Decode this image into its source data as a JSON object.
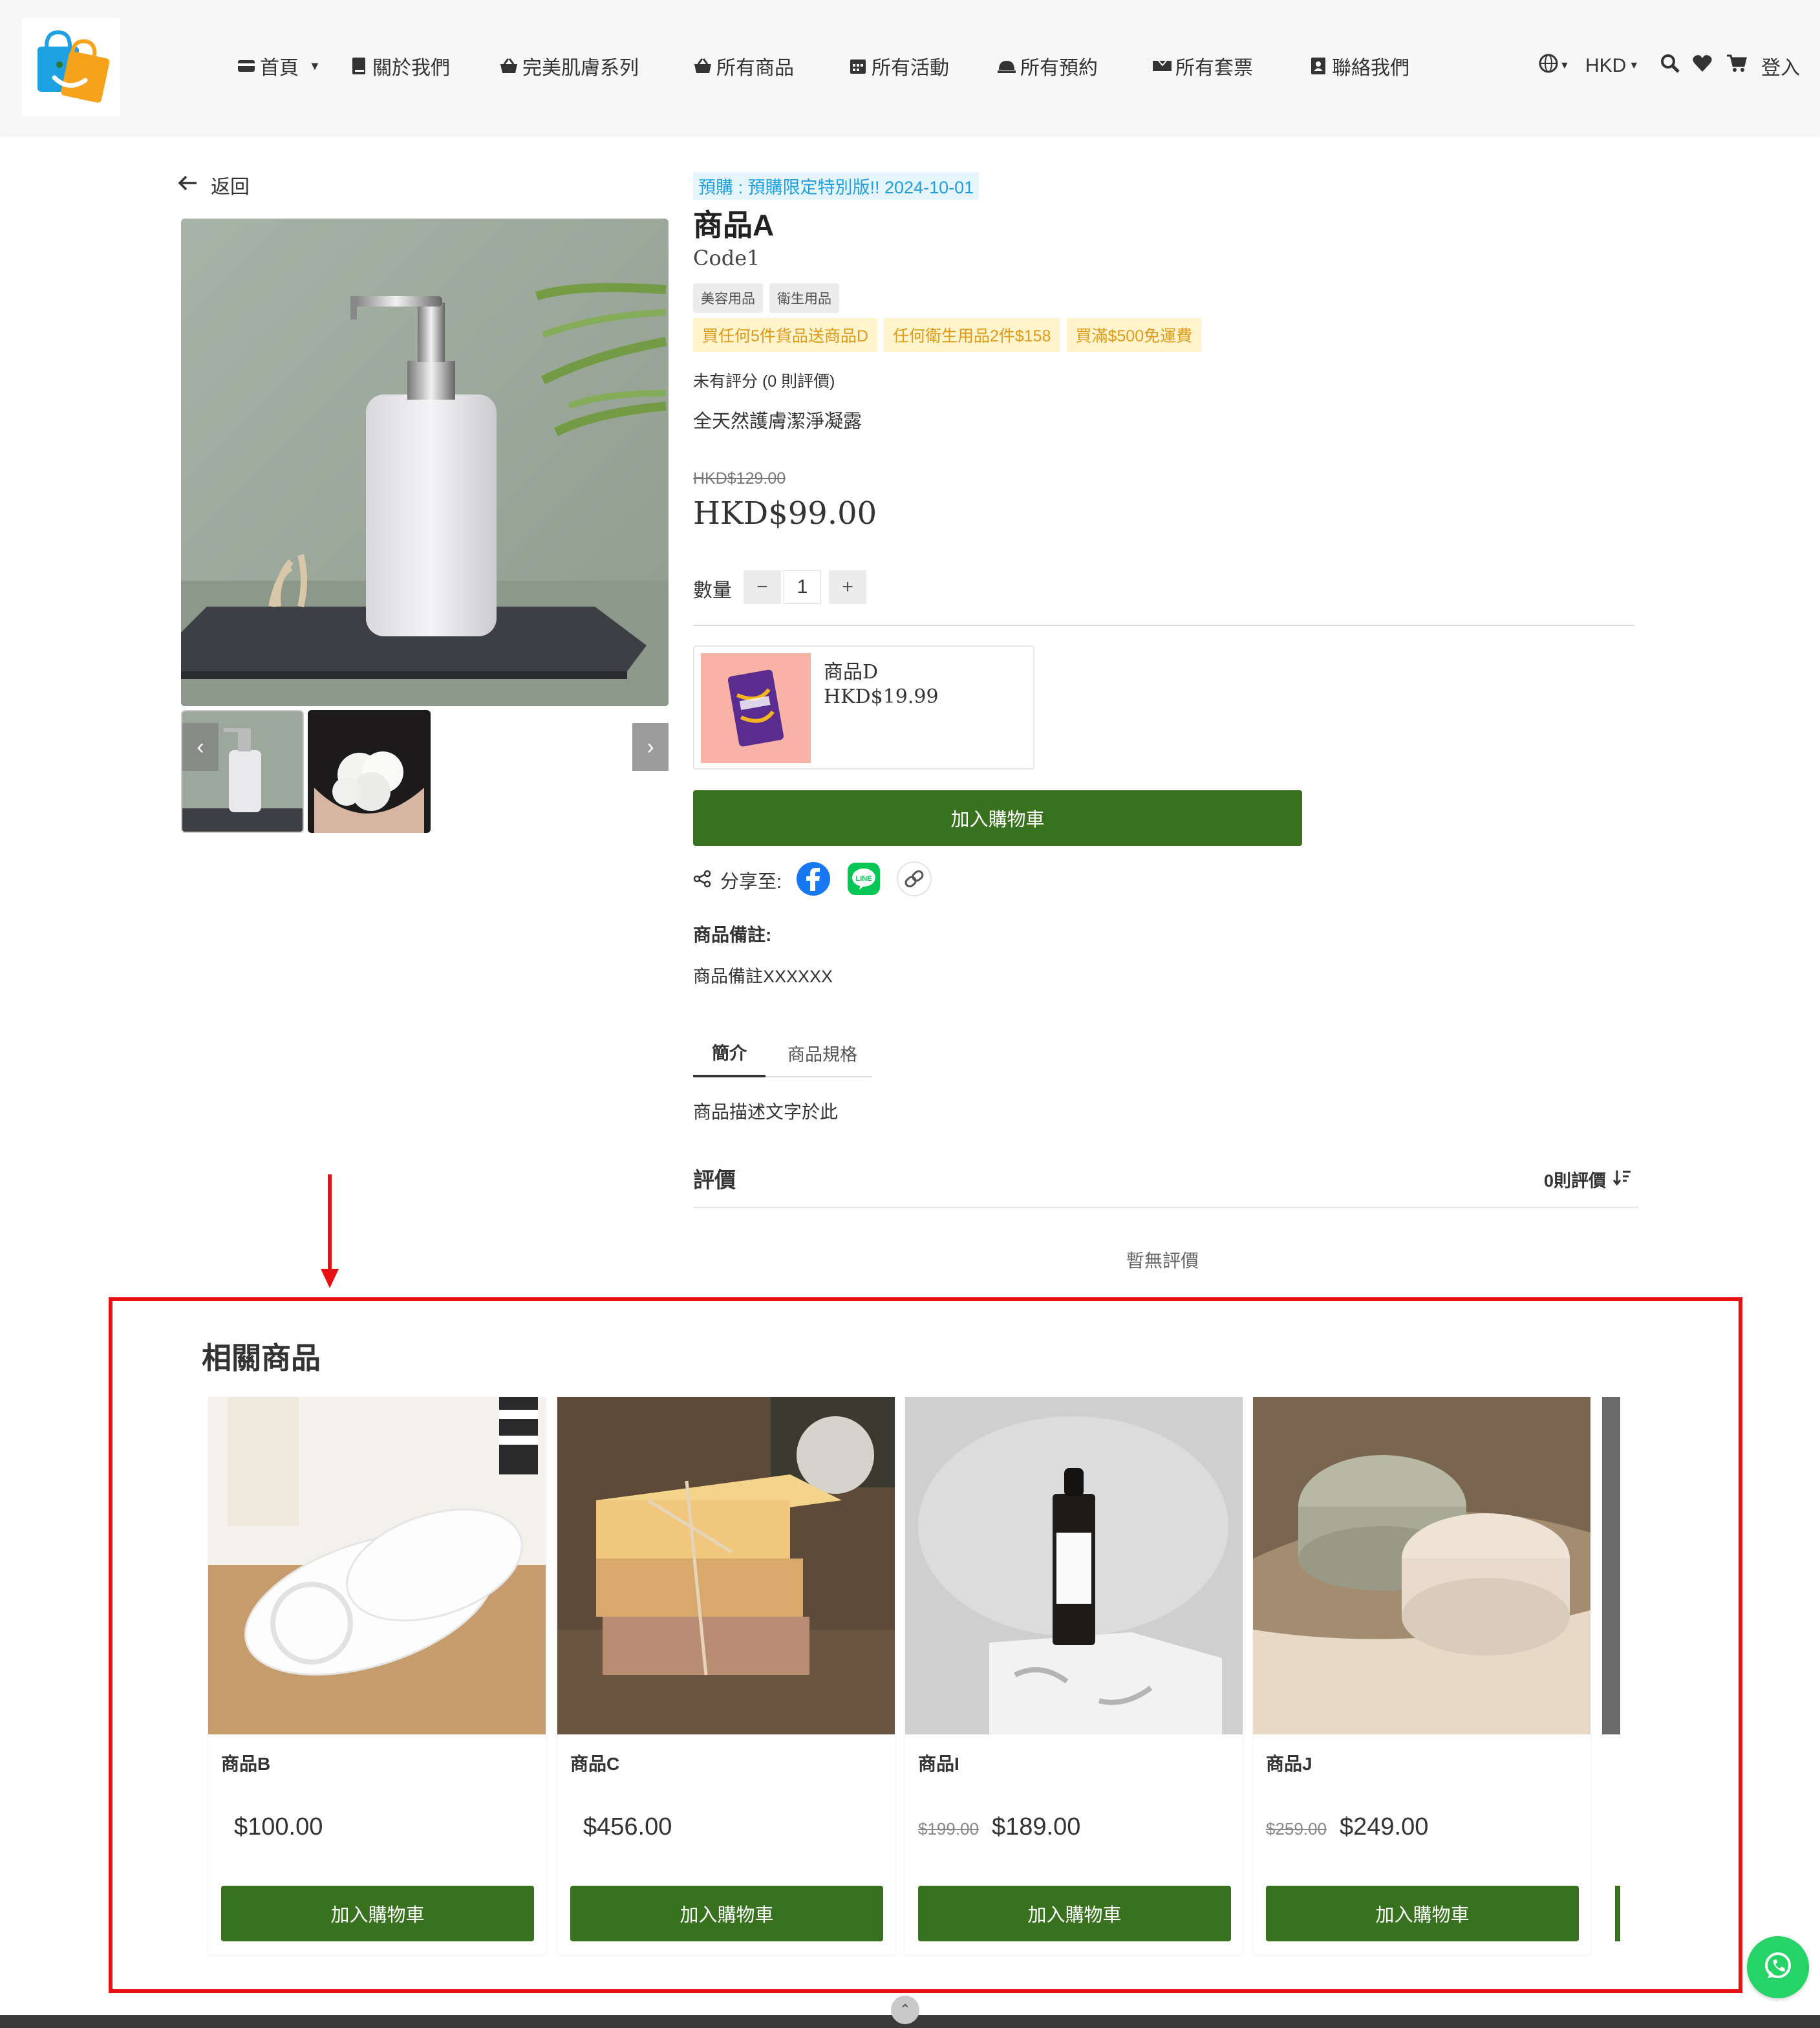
{
  "nav": {
    "items": [
      {
        "label": "首頁"
      },
      {
        "label": "關於我們"
      },
      {
        "label": "完美肌膚系列"
      },
      {
        "label": "所有商品"
      },
      {
        "label": "所有活動"
      },
      {
        "label": "所有預約"
      },
      {
        "label": "所有套票"
      },
      {
        "label": "聯絡我們"
      }
    ],
    "currency": "HKD",
    "login": "登入"
  },
  "back_label": "返回",
  "product": {
    "preorder": "預購 : 預購限定特別版!! 2024-10-01",
    "title": "商品A",
    "code": "Code1",
    "tags": [
      "美容用品",
      "衛生用品"
    ],
    "promos": [
      "買任何5件貨品送商品D",
      "任何衛生用品2件$158",
      "買滿$500免運費"
    ],
    "rating": "未有評分 (0 則評價)",
    "subtitle": "全天然護膚潔淨凝露",
    "old_price": "HKD$129.00",
    "price": "HKD$99.00",
    "qty_label": "數量",
    "qty": "1",
    "gift": {
      "name": "商品D",
      "price": "HKD$19.99"
    },
    "add_to_cart": "加入購物車",
    "share_label": "分享至:",
    "remark_title": "商品備註:",
    "remark": "商品備註XXXXXX",
    "tabs": [
      "簡介",
      "商品規格"
    ],
    "description": "商品描述文字於此"
  },
  "reviews": {
    "title": "評價",
    "count": "0則評價",
    "empty": "暫無評價"
  },
  "related": {
    "title": "相關商品",
    "items": [
      {
        "name": "商品B",
        "price": "$100.00",
        "old_price": "",
        "button": "加入購物車"
      },
      {
        "name": "商品C",
        "price": "$456.00",
        "old_price": "",
        "button": "加入購物車"
      },
      {
        "name": "商品I",
        "price": "$189.00",
        "old_price": "$199.00",
        "button": "加入購物車"
      },
      {
        "name": "商品J",
        "price": "$249.00",
        "old_price": "$259.00",
        "button": "加入購物車"
      }
    ]
  },
  "colors": {
    "brand_green": "#38721e",
    "highlight_red": "#e81010",
    "whatsapp": "#25d366",
    "preorder_blue": "#1e9fe0"
  }
}
